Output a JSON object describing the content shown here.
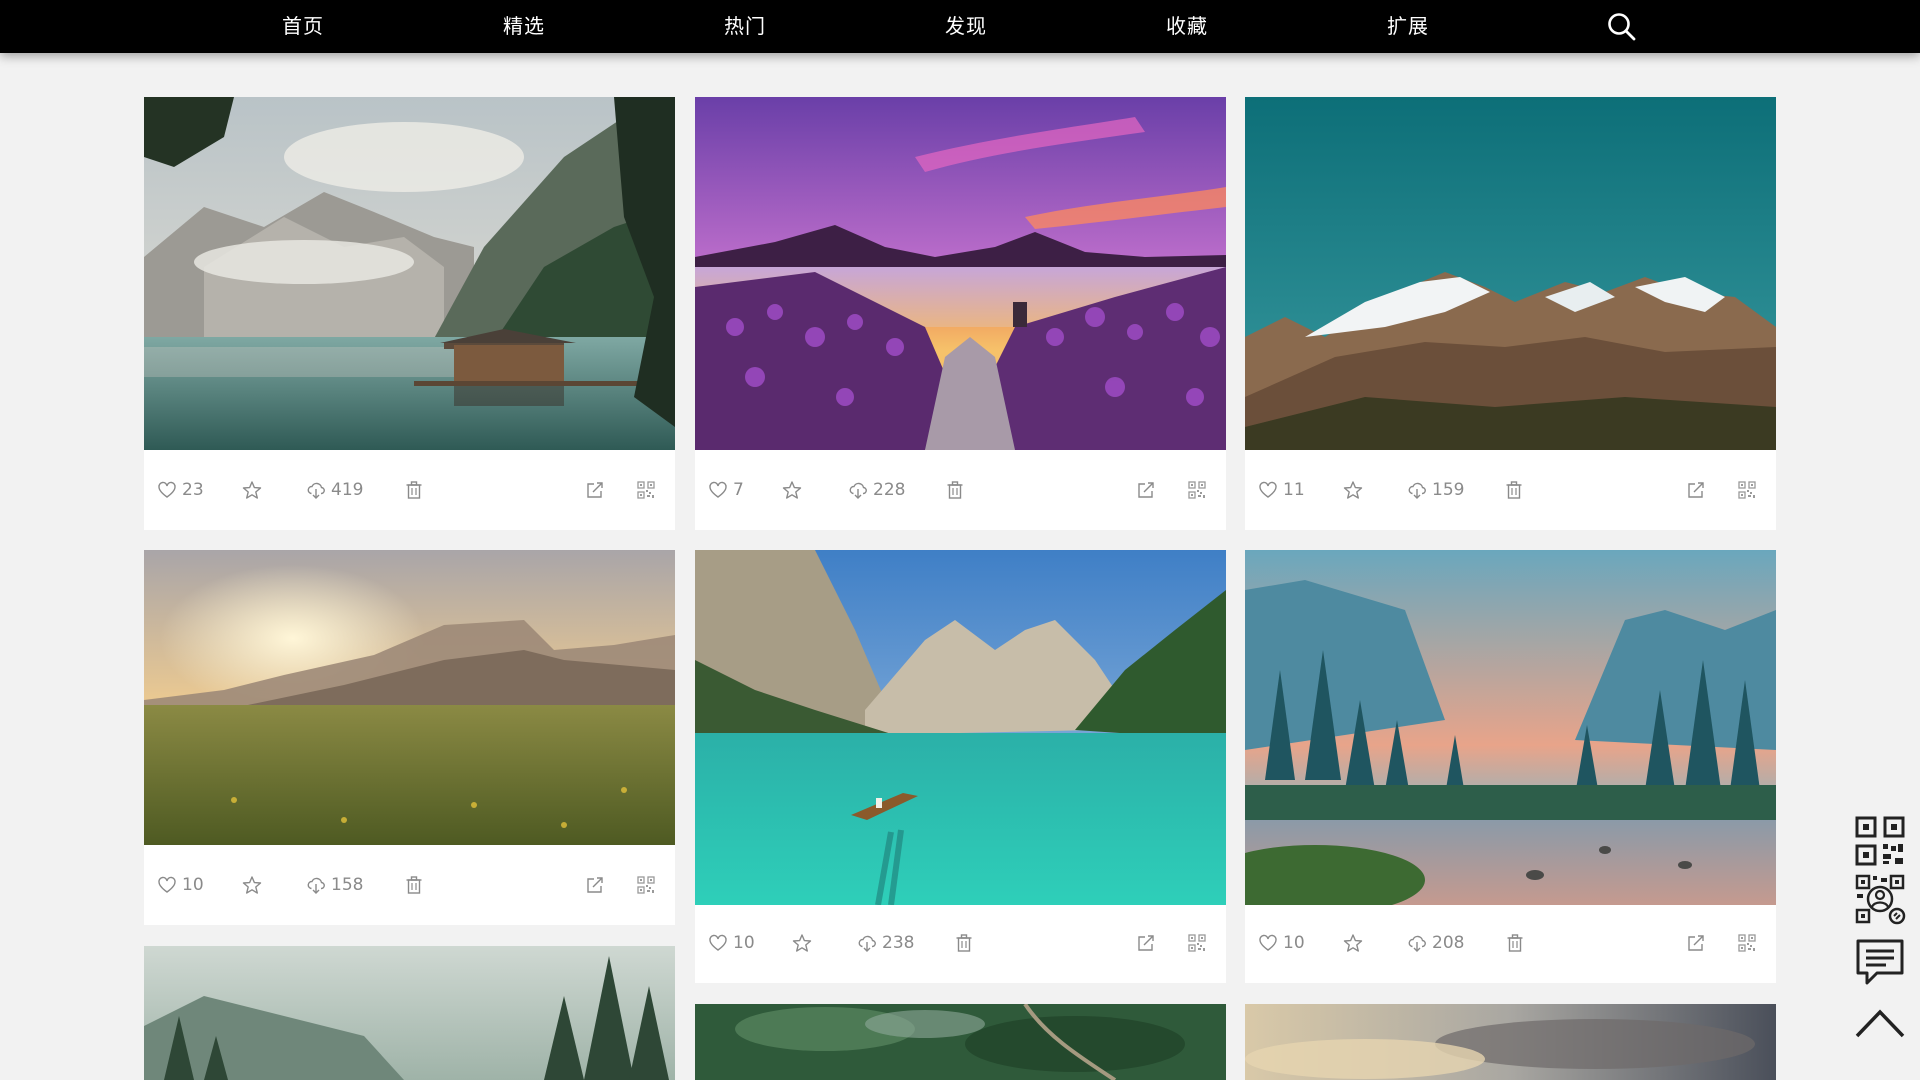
{
  "nav": {
    "items": [
      "首页",
      "精选",
      "热门",
      "发现",
      "收藏",
      "扩展"
    ],
    "search_icon": "search-icon"
  },
  "cards": [
    {
      "scene": "lake-boathouse-dolomites",
      "likes": "23",
      "downloads": "419"
    },
    {
      "scene": "lavender-field-sunset-lake",
      "likes": "7",
      "downloads": "228"
    },
    {
      "scene": "snowy-mountain-teal-sky",
      "likes": "11",
      "downloads": "159"
    },
    {
      "scene": "grass-meadow-sunrise-mountains",
      "likes": "10",
      "downloads": "158"
    },
    {
      "scene": "turquoise-lake-rowboat",
      "likes": "10",
      "downloads": "238"
    },
    {
      "scene": "yosemite-valley-river-dusk",
      "likes": "10",
      "downloads": "208"
    },
    {
      "scene": "misty-pine-forest",
      "likes": "",
      "downloads": ""
    },
    {
      "scene": "green-forest-aerial-road",
      "likes": "",
      "downloads": ""
    },
    {
      "scene": "cloudy-sunset-sky",
      "likes": "",
      "downloads": ""
    }
  ],
  "card_action_icons": [
    "heart-icon",
    "star-icon",
    "cloud-download-icon",
    "trash-icon",
    "share-icon",
    "qrcode-icon"
  ],
  "side_tools": [
    "qrcode-icon",
    "wechat-qrcode-icon",
    "comment-icon",
    "back-to-top-icon"
  ],
  "colors": {
    "nav_bg": "#000000",
    "nav_text": "#ffffff",
    "page_bg": "#f2f2f2",
    "card_bg": "#ffffff",
    "action_text": "#8a8a8a"
  }
}
